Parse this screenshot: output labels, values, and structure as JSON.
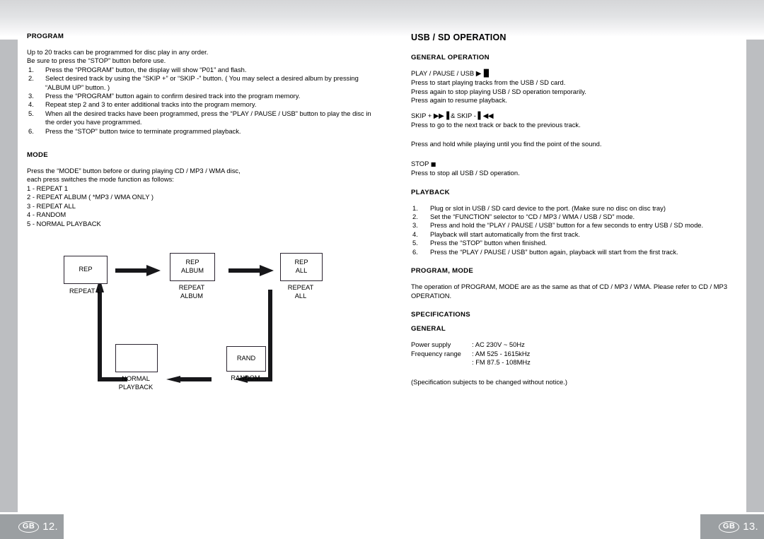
{
  "document": {
    "left_page": {
      "sections": [
        {
          "heading": "PROGRAM",
          "intro": [
            "Up to 20 tracks can be programmed for disc play in any order.",
            "Be sure to press the “STOP” button before use."
          ],
          "steps": [
            "Press the “PROGRAM” button, the display will show “P01” and flash.",
            "Select desired track by using the “SKIP +” or “SKIP -” button. ( You may select a desired album by pressing “ALBUM UP” button. )",
            "Press the “PROGRAM” button again to confirm desired track into the program memory.",
            "Repeat step 2 and 3 to enter additional tracks into the program memory.",
            "When all the desired tracks have been programmed, press the “PLAY / PAUSE / USB” button to play the disc in the order you have programmed.",
            "Press the “STOP” button twice to terminate programmed playback."
          ]
        },
        {
          "heading": "MODE",
          "intro": [
            "Press the “MODE” button before or during playing CD / MP3 / WMA disc,",
            "each press switches the mode function as follows:"
          ],
          "modes": [
            "1 - REPEAT 1",
            "2 - REPEAT ALBUM ( *MP3 / WMA ONLY )",
            "3 - REPEAT ALL",
            "4 - RANDOM",
            "5 - NORMAL PLAYBACK"
          ]
        }
      ]
    },
    "right_page": {
      "title": "USB / SD OPERATION",
      "sections": [
        {
          "heading": "GENERAL OPERATION",
          "blocks": [
            {
              "label": "PLAY / PAUSE / USB",
              "icon": "play-pause-icon",
              "icon_glyph": "▶▐▌",
              "lines": [
                "Press to start playing tracks from the USB / SD card.",
                "Press again to stop playing USB / SD operation temporarily.",
                "Press again to resume playback."
              ]
            },
            {
              "label_parts": [
                "SKIP + ",
                " & SKIP - "
              ],
              "icon": "skip-next-prev-icon",
              "icon_glyph_next": "▶▶▐",
              "icon_glyph_prev": "▌◀◀",
              "lines": [
                "Press to go to the next track or back to the previous track."
              ],
              "extra_line": "Press and hold while playing until you find the point of the sound."
            },
            {
              "label": "STOP",
              "icon": "stop-icon",
              "icon_glyph": "■",
              "lines": [
                "Press to stop all USB / SD operation."
              ]
            }
          ]
        },
        {
          "heading": "PLAYBACK",
          "steps": [
            "Plug or slot in USB / SD card device to the port. (Make sure no disc on disc tray)",
            "Set the “FUNCTION” selector to “CD / MP3 / WMA / USB / SD” mode.",
            "Press and hold the “PLAY / PAUSE / USB” button for a few seconds to entry USB / SD mode.",
            "Playback will start automatically from the first track.",
            "Press the “STOP” button when finished.",
            "Press the “PLAY / PAUSE / USB” button again, playback will start from the first track."
          ]
        },
        {
          "heading": "PROGRAM, MODE",
          "paragraph": "The operation of PROGRAM, MODE are as the same as that of CD / MP3 / WMA. Please refer to CD / MP3 OPERATION."
        },
        {
          "heading": "SPECIFICATIONS",
          "subheading": "GENERAL",
          "specs": [
            {
              "key": "Power supply",
              "value": ": AC 230V ~ 50Hz"
            },
            {
              "key": "Frequency range",
              "value": ": AM 525 - 1615kHz"
            },
            {
              "key": "",
              "value": ": FM 87.5 - 108MHz"
            }
          ],
          "note": "(Specification subjects to be changed without notice.)"
        }
      ]
    }
  },
  "diagram": {
    "name": "mode-cycle-diagram",
    "nodes": [
      {
        "box_text": "REP",
        "caption": "REPEAT 1"
      },
      {
        "box_text": "REP\nALBUM",
        "caption": "REPEAT\nALBUM"
      },
      {
        "box_text": "REP\nALL",
        "caption": "REPEAT\nALL"
      },
      {
        "box_text": "RAND",
        "caption": "RANDOM"
      },
      {
        "box_text": "",
        "caption": "NORMAL\nPLAYBACK"
      }
    ]
  },
  "footer": {
    "left": {
      "badge": "GB",
      "page": "12."
    },
    "right": {
      "badge": "GB",
      "page": "13."
    }
  },
  "colors": {
    "edge_bar": "#bcbec1",
    "footer_bar": "#9b9fa2",
    "ink": "#000000",
    "diagram_stroke": "#2b2430"
  }
}
